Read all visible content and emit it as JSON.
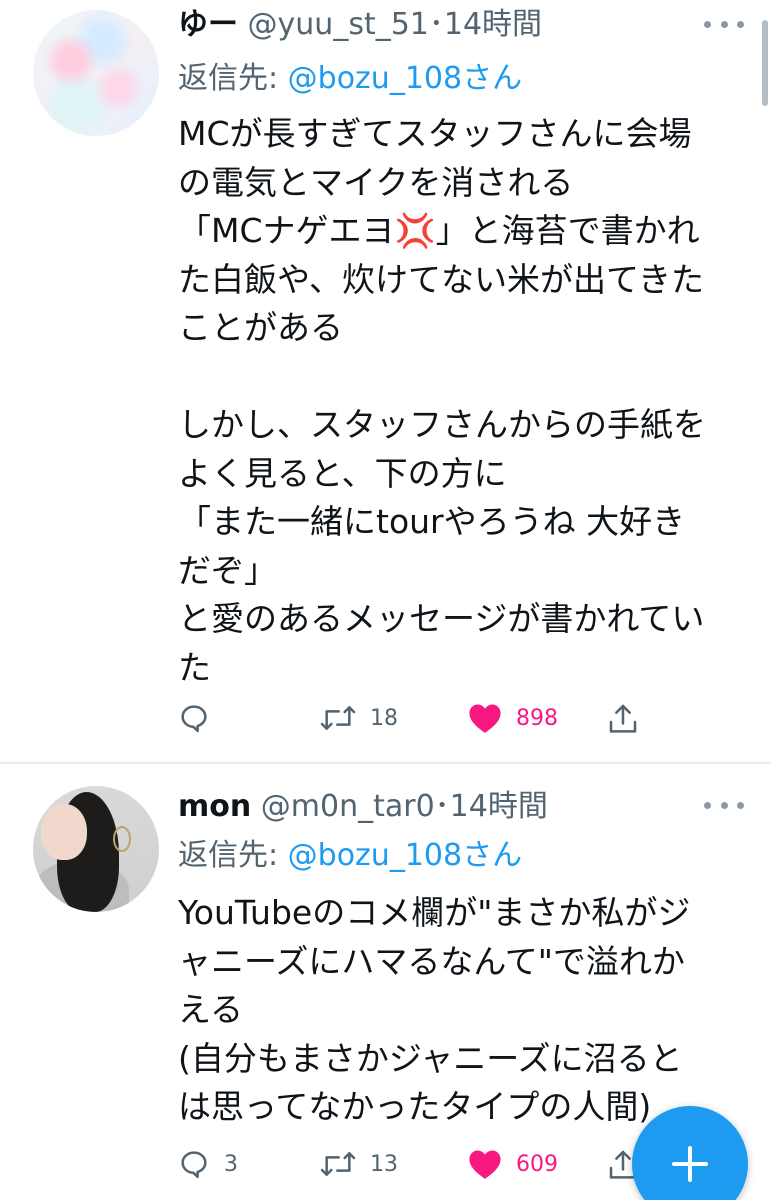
{
  "colors": {
    "accent": "#1d9bf0",
    "like": "#f91880",
    "secondary_text": "#536471",
    "primary_text": "#0f1419"
  },
  "tweets": [
    {
      "display_name": "ゆー",
      "handle_time": " @yuu_st_51･14時間",
      "reply_prefix": "返信先: ",
      "reply_handle": "@bozu_108さん",
      "text": "MCが長すぎてスタッフさんに会場\nの電気とマイクを消される\n「MCナゲエヨ💢」と海苔で書かれ\nた白飯や、炊けてない米が出てきた\nことがある\n\nしかし、スタッフさんからの手紙を\nよく見ると、下の方に\n「また一緒にtourやろうね 大好き\nだぞ」\nと愛のあるメッセージが書かれてい\nた",
      "reply_count": "",
      "retweet_count": "18",
      "like_count": "898",
      "liked": true
    },
    {
      "display_name": "mon",
      "handle_time": " @m0n_tar0･14時間",
      "reply_prefix": "返信先: ",
      "reply_handle": "@bozu_108さん",
      "text": "YouTubeのコメ欄が\"まさか私がジ\nャニーズにハマるなんて\"で溢れか\nえる\n(自分もまさかジャニーズに沼ると\nは思ってなかったタイプの人間)",
      "reply_count": "3",
      "retweet_count": "13",
      "like_count": "609",
      "liked": true
    }
  ],
  "icons": {
    "reply": "reply-icon",
    "retweet": "retweet-icon",
    "like": "heart-icon",
    "share": "share-icon",
    "more": "more-icon",
    "compose": "plus-icon"
  }
}
